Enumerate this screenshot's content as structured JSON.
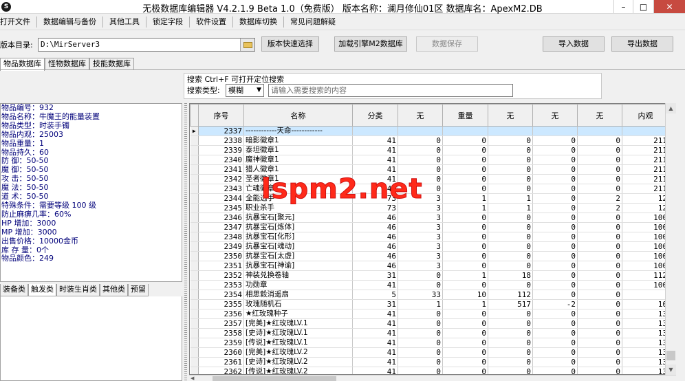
{
  "window": {
    "title": "无极数据库编辑器 V4.2.1.9   Beta 1.0（免费版）    版本名称：澜月修仙01区     数据库名：ApexM2.DB",
    "controls": [
      "–",
      "□",
      "✕"
    ]
  },
  "menu": [
    "打开文件",
    "数据编辑与备份",
    "其他工具",
    "锁定字段",
    "软件设置",
    "数据库切换",
    "常见问题解疑"
  ],
  "toolbar": {
    "dir_label": "版本目录:",
    "dir_value": "D:\\MirServer3",
    "btn_quick_select": "版本快速选择",
    "btn_load_engine": "加载引擎M2数据库",
    "btn_save": "数据保存",
    "btn_import": "导入数据",
    "btn_export": "导出数据"
  },
  "tabs_top": [
    "物品数据库",
    "怪物数据库",
    "技能数据库"
  ],
  "search": {
    "hint": "搜索  Ctrl+F 可打开定位搜索",
    "type_label": "搜索类型:",
    "type_value": "模糊",
    "placeholder": "请输入需要搜索的内容"
  },
  "item_info": [
    "物品编号：932",
    "物品名称：牛魔王的能量装置",
    "物品类型：时装手镯",
    "物品内观：25003",
    "物品重量：1",
    "物品持久：60",
    "防    御：50-50",
    "魔    御：50-50",
    "攻    击：50-50",
    "魔    法：50-50",
    "道    术：50-50",
    "特殊条件：需要等级 100 级",
    "防止麻痹几率：60%",
    "HP  增加：3000",
    "MP  增加：3000",
    "出售价格：10000金币",
    "库 存 量：0个",
    "物品颜色：249"
  ],
  "tabs_bottom": [
    "装备类",
    "触发类",
    "时装生肖类",
    "其他类",
    "预留"
  ],
  "grid": {
    "headers": [
      "序号",
      "名称",
      "分类",
      "无",
      "重量",
      "无",
      "无",
      "无",
      "内观"
    ],
    "rows": [
      [
        "2337",
        "------------天命------------",
        "",
        "",
        "",
        "",
        "",
        "",
        ""
      ],
      [
        "2338",
        "暗影徽章1",
        "41",
        "0",
        "0",
        "0",
        "0",
        "0",
        "211"
      ],
      [
        "2339",
        "泰坦徽章1",
        "41",
        "0",
        "0",
        "0",
        "0",
        "0",
        "211"
      ],
      [
        "2340",
        "魔神徽章1",
        "41",
        "0",
        "0",
        "0",
        "0",
        "0",
        "211"
      ],
      [
        "2341",
        "猎人徽章1",
        "41",
        "0",
        "0",
        "0",
        "0",
        "0",
        "211"
      ],
      [
        "2342",
        "圣者徽章1",
        "41",
        "0",
        "0",
        "0",
        "0",
        "0",
        "211"
      ],
      [
        "2343",
        "亡魂徽章1",
        "41",
        "0",
        "0",
        "0",
        "0",
        "0",
        "211"
      ],
      [
        "2344",
        "全能选手",
        "73",
        "3",
        "1",
        "1",
        "0",
        "2",
        "12"
      ],
      [
        "2345",
        "职业杀手",
        "73",
        "3",
        "1",
        "1",
        "0",
        "2",
        "12"
      ],
      [
        "2346",
        "抗暴宝石[聚元]",
        "46",
        "3",
        "0",
        "0",
        "0",
        "0",
        "100"
      ],
      [
        "2347",
        "抗暴宝石[炼体]",
        "46",
        "3",
        "0",
        "0",
        "0",
        "0",
        "100"
      ],
      [
        "2348",
        "抗暴宝石[化形]",
        "46",
        "3",
        "0",
        "0",
        "0",
        "0",
        "100"
      ],
      [
        "2349",
        "抗暴宝石[魂动]",
        "46",
        "3",
        "0",
        "0",
        "0",
        "0",
        "100"
      ],
      [
        "2350",
        "抗暴宝石[太虚]",
        "46",
        "3",
        "0",
        "0",
        "0",
        "0",
        "100"
      ],
      [
        "2351",
        "抗暴宝石[神谕]",
        "46",
        "3",
        "0",
        "0",
        "0",
        "0",
        "100"
      ],
      [
        "2352",
        "神装兑换卷轴",
        "31",
        "0",
        "1",
        "18",
        "0",
        "0",
        "112"
      ],
      [
        "2353",
        "功勋章",
        "41",
        "0",
        "0",
        "0",
        "0",
        "0",
        "100"
      ],
      [
        "2354",
        "相思縠消遥扇",
        "5",
        "33",
        "10",
        "112",
        "0",
        "0",
        ""
      ],
      [
        "2355",
        "玫瑰随机石",
        "31",
        "1",
        "1",
        "517",
        "-2",
        "0",
        "10"
      ],
      [
        "2356",
        "★红玫瑰种子",
        "41",
        "0",
        "0",
        "0",
        "0",
        "0",
        "13"
      ],
      [
        "2357",
        "[完美]★红玫瑰LV.1",
        "41",
        "0",
        "0",
        "0",
        "0",
        "0",
        "13"
      ],
      [
        "2358",
        "[史诗]★红玫瑰LV.1",
        "41",
        "0",
        "0",
        "0",
        "0",
        "0",
        "13"
      ],
      [
        "2359",
        "[传说]★红玫瑰LV.1",
        "41",
        "0",
        "0",
        "0",
        "0",
        "0",
        "13"
      ],
      [
        "2360",
        "[完美]★红玫瑰LV.2",
        "41",
        "0",
        "0",
        "0",
        "0",
        "0",
        "13"
      ],
      [
        "2361",
        "[史诗]★红玫瑰LV.2",
        "41",
        "0",
        "0",
        "0",
        "0",
        "0",
        "13"
      ],
      [
        "2362",
        "[传说]★红玫瑰LV.2",
        "41",
        "0",
        "0",
        "0",
        "0",
        "0",
        "13"
      ]
    ]
  },
  "watermark": "lspm2.net",
  "colors": {
    "info_text": "#00007a",
    "selected_row": "#cce8ff",
    "watermark": "#ff2a1a",
    "close_button": "#c74a40"
  }
}
